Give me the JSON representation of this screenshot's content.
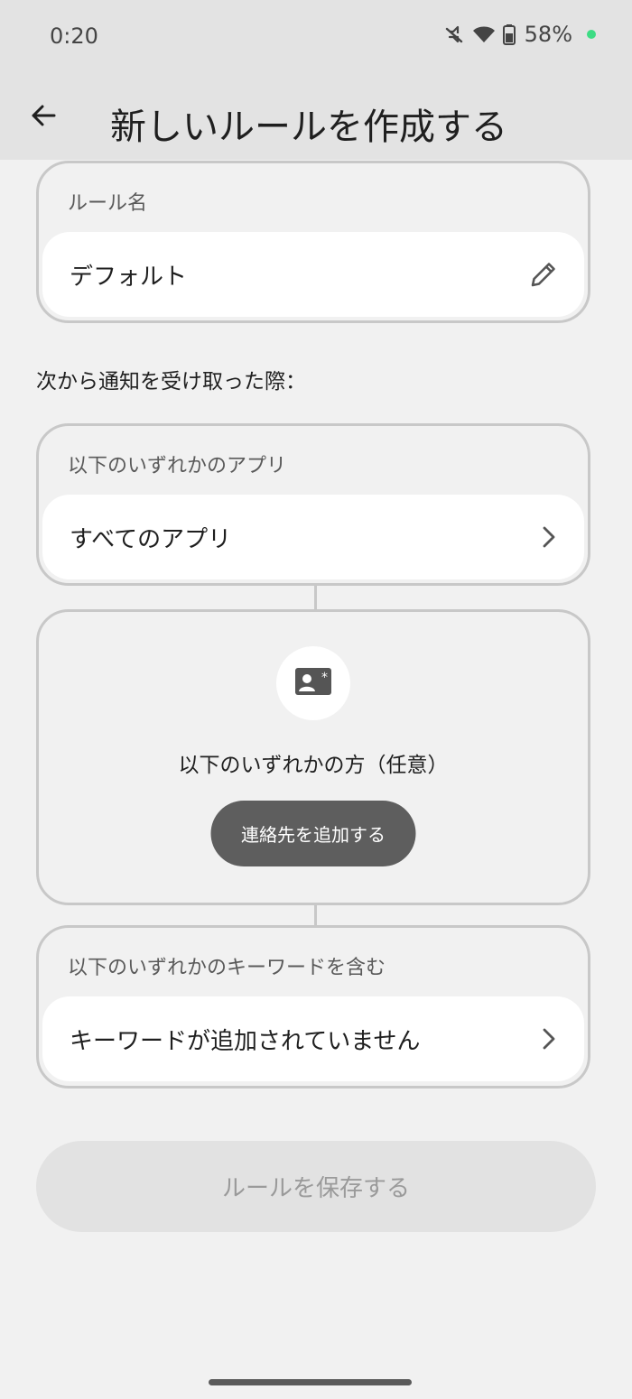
{
  "status_bar": {
    "time": "0:20",
    "battery_percent": "58%",
    "icons": [
      "mute-icon",
      "wifi-icon",
      "battery-icon"
    ],
    "dot_color": "#3ddc84"
  },
  "header": {
    "title": "新しいルールを作成する",
    "back_icon": "back-arrow-icon"
  },
  "rule_name": {
    "label": "ルール名",
    "value": "デフォルト",
    "edit_icon": "pencil-icon"
  },
  "caption": "次から通知を受け取った際：",
  "apps": {
    "label": "以下のいずれかのアプリ",
    "value": "すべてのアプリ",
    "icon": "chevron-right-icon"
  },
  "contacts": {
    "icon": "contact-card-icon",
    "title": "以下のいずれかの方（任意）",
    "button_label": "連絡先を追加する"
  },
  "keywords": {
    "label": "以下のいずれかのキーワードを含む",
    "value": "キーワードが追加されていません",
    "icon": "chevron-right-icon"
  },
  "save_button": {
    "label": "ルールを保存する"
  },
  "colors": {
    "background": "#f1f1f1",
    "topbar": "#e3e3e3",
    "card_border": "#c8c8c8",
    "row_bg": "#ffffff",
    "dark_button": "#5e5e5e",
    "disabled_button": "#e2e2e2",
    "disabled_text": "#9a9a9a"
  }
}
